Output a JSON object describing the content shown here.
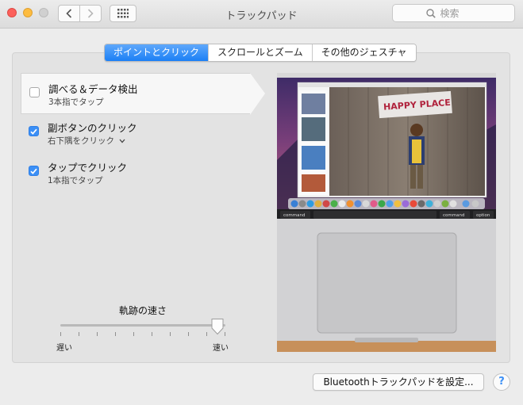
{
  "window": {
    "title": "トラックパッド"
  },
  "search": {
    "placeholder": "検索"
  },
  "tabs": [
    {
      "label": "ポイントとクリック",
      "active": true
    },
    {
      "label": "スクロールとズーム",
      "active": false
    },
    {
      "label": "その他のジェスチャ",
      "active": false
    }
  ],
  "options": [
    {
      "title": "調べる＆データ検出",
      "subtitle": "3本指でタップ",
      "checked": false,
      "selected": true
    },
    {
      "title": "副ボタンのクリック",
      "subtitle": "右下隅をクリック",
      "checked": true,
      "selected": false,
      "has_menu": true
    },
    {
      "title": "タップでクリック",
      "subtitle": "1本指でタップ",
      "checked": true,
      "selected": false
    }
  ],
  "tracking_speed": {
    "title": "軌跡の速さ",
    "min_label": "遅い",
    "max_label": "速い",
    "value_fraction": 0.95,
    "tick_count": 10
  },
  "preview": {
    "keyboard_keys": [
      "command",
      "command",
      "option"
    ],
    "banner_text": "HAPPY PLACE"
  },
  "footer": {
    "bluetooth_button": "Bluetoothトラックパッドを設定...",
    "help_button": "?"
  },
  "colors": {
    "accent": "#1b7ff5",
    "checkbox_checked": "#3b8ff6"
  }
}
